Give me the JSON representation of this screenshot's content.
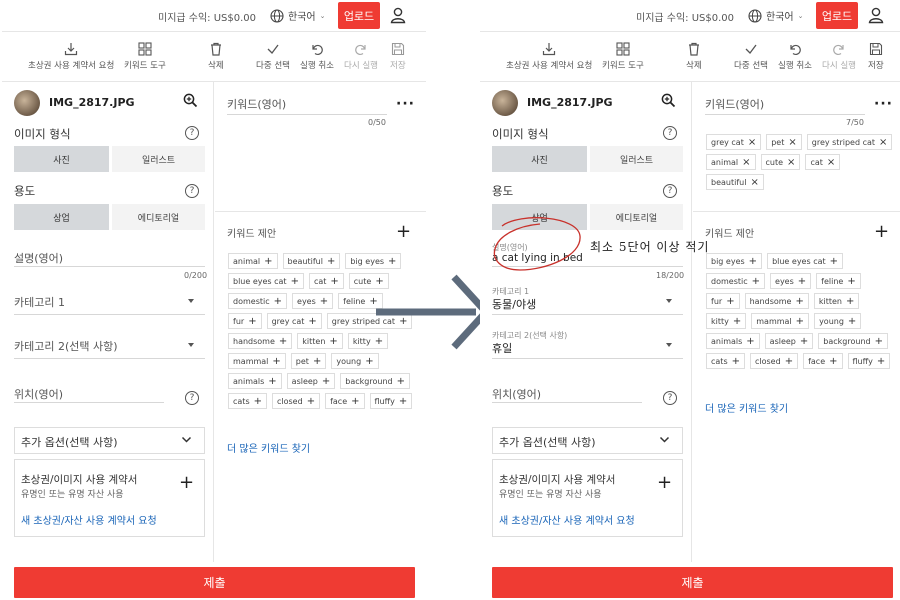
{
  "topbar": {
    "earnings": "미지급 수익: US$0.00",
    "language": "한국어",
    "upload": "업로드"
  },
  "toolbar": {
    "consent_request": "초상권 사용 계약서 요청",
    "keyword_tool": "키워드 도구",
    "delete": "삭제",
    "multi_select": "다중 선택",
    "undo": "실행 취소",
    "redo": "다시 실행",
    "save": "저장"
  },
  "file": {
    "name": "IMG_2817.JPG"
  },
  "image_type": {
    "label": "이미지 형식",
    "options": [
      "사진",
      "일러스트"
    ],
    "selected": "사진"
  },
  "usage": {
    "label": "용도",
    "options": [
      "상업",
      "에디토리얼"
    ],
    "selected": "상업"
  },
  "left_panel": {
    "description_label": "설명(영어)",
    "description_counter": "0/200",
    "category1": "카테고리 1",
    "category2": "카테고리 2(선택 사항)",
    "location_label": "위치(영어)",
    "extra_options": "추가 옵션(선택 사항)",
    "release_title": "초상권/이미지 사용 계약서",
    "release_subtitle": "유명인 또는 유명 자산 사용",
    "release_link": "새 초상권/자산 사용 계약서 요청",
    "keywords_label": "키워드(영어)",
    "keywords_counter": "0/50",
    "suggestions_label": "키워드 제안",
    "suggestions": [
      "animal",
      "beautiful",
      "big eyes",
      "blue eyes cat",
      "cat",
      "cute",
      "domestic",
      "eyes",
      "feline",
      "fur",
      "grey cat",
      "grey striped cat",
      "handsome",
      "kitten",
      "kitty",
      "mammal",
      "pet",
      "young",
      "animals",
      "asleep",
      "background",
      "cats",
      "closed",
      "face",
      "fluffy"
    ],
    "more_keywords": "더 많은 키워드 찾기",
    "submit": "제출"
  },
  "right_panel": {
    "description_small_label": "설명(영어)",
    "description_value": "a cat lying in bed",
    "description_counter": "18/200",
    "category1_small": "카테고리 1",
    "category1_value": "동물/야생",
    "category2_small": "카테고리 2(선택 사항)",
    "category2_value": "휴일",
    "location_label": "위치(영어)",
    "extra_options": "추가 옵션(선택 사항)",
    "release_title": "초상권/이미지 사용 계약서",
    "release_subtitle": "유명인 또는 유명 자산 사용",
    "release_link": "새 초상권/자산 사용 계약서 요청",
    "keywords_label": "키워드(영어)",
    "keywords_counter": "7/50",
    "selected_keywords": [
      "grey cat",
      "pet",
      "grey striped cat",
      "animal",
      "cute",
      "cat",
      "beautiful"
    ],
    "suggestions_label": "키워드 제안",
    "suggestions": [
      "big eyes",
      "blue eyes cat",
      "domestic",
      "eyes",
      "feline",
      "fur",
      "handsome",
      "kitten",
      "kitty",
      "mammal",
      "young",
      "animals",
      "asleep",
      "background",
      "cats",
      "closed",
      "face",
      "fluffy"
    ],
    "more_keywords": "더 많은 키워드 찾기",
    "submit": "제출"
  },
  "annotation": {
    "note": "최소 5단어 이상 적기"
  },
  "colors": {
    "accent_red": "#ef3b33",
    "link_blue": "#1a65b8",
    "active_seg": "#d5d8db",
    "arrow": "#5d6b7c"
  }
}
